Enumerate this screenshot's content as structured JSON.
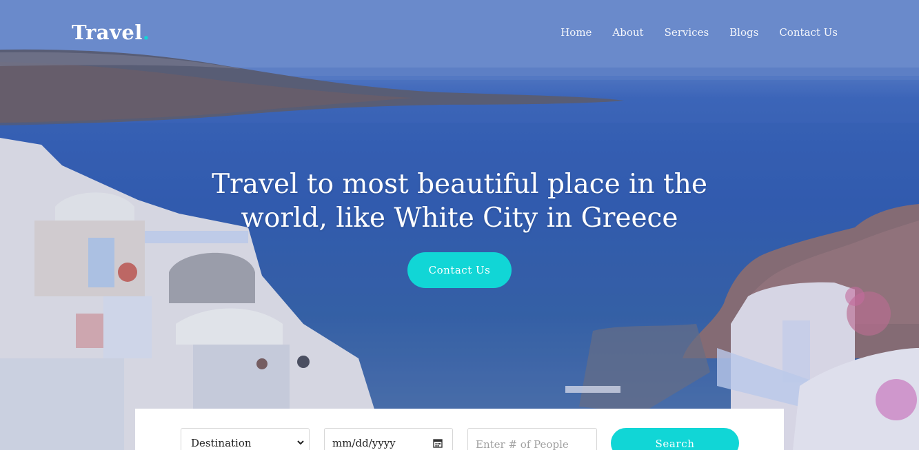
{
  "brand": {
    "name": "Travel",
    "dot": ".",
    "accent": "#11d6d6"
  },
  "nav": {
    "items": [
      {
        "label": "Home"
      },
      {
        "label": "About"
      },
      {
        "label": "Services"
      },
      {
        "label": "Blogs"
      },
      {
        "label": "Contact Us"
      }
    ]
  },
  "hero": {
    "headline": "Travel to most beautiful place in the world, like White City in Greece",
    "cta_label": "Contact Us",
    "background_icon": "santorini-photo"
  },
  "search": {
    "destination_value": "Destination",
    "date_placeholder": "mm/dd/yyyy",
    "people_placeholder": "Enter # of People",
    "button_label": "Search"
  },
  "colors": {
    "accent": "#11d6d6",
    "sea": "#2f58ad"
  }
}
